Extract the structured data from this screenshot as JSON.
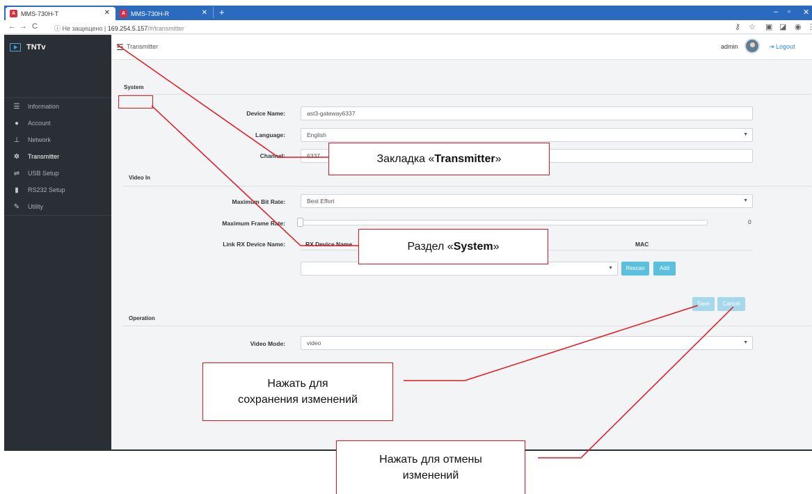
{
  "browser": {
    "tabs": [
      {
        "title": "MMS-730H-T",
        "favicon": "angular-icon",
        "active": true
      },
      {
        "title": "MMS-730H-R",
        "favicon": "angular-icon",
        "active": false
      }
    ],
    "new_tab": "+",
    "window_controls": {
      "minimize": "–",
      "maximize": "▫",
      "close": "✕"
    },
    "address": {
      "security_label": "Не защищено",
      "host": "169.254.5.157",
      "path": "/#/transmitter"
    }
  },
  "app": {
    "brand": "TNTv",
    "breadcrumb": "Transmitter",
    "user": "admin",
    "logout": "Logout",
    "sidebar": [
      {
        "label": "Information",
        "icon": "list-icon",
        "active": false
      },
      {
        "label": "Account",
        "icon": "user-icon",
        "active": false
      },
      {
        "label": "Network",
        "icon": "sitemap-icon",
        "active": false
      },
      {
        "label": "Transmitter",
        "icon": "gear-icon",
        "active": true
      },
      {
        "label": "USB Setup",
        "icon": "usb-icon",
        "active": false
      },
      {
        "label": "RS232 Setup",
        "icon": "port-icon",
        "active": false
      },
      {
        "label": "Utility",
        "icon": "wrench-icon",
        "active": false
      }
    ]
  },
  "form": {
    "system": {
      "title": "System",
      "device_name_label": "Device Name:",
      "device_name_value": "ast3-gateway6337",
      "language_label": "Language:",
      "language_value": "English",
      "channel_label": "Channel:",
      "channel_value": "6337"
    },
    "video_in": {
      "title": "Video In",
      "max_bitrate_label": "Maximum Bit Rate:",
      "max_bitrate_value": "Best Effort",
      "max_framerate_label": "Maximum Frame Rate:",
      "max_framerate_value": "0",
      "link_rx_label": "Link RX Device Name:",
      "col_rx_device_name": "RX Device Name",
      "col_mac": "MAC",
      "rx_select_value": "",
      "rescan": "Rescan",
      "add": "Add"
    },
    "save": "Save",
    "cancel": "Cancel",
    "operation": {
      "title": "Operation",
      "video_mode_label": "Video Mode:",
      "video_mode_value": "video"
    }
  },
  "annotations": {
    "transmitter_tab": {
      "prefix": "Закладка «",
      "bold": "Transmitter",
      "suffix": "»"
    },
    "system_section": {
      "prefix": "Раздел «",
      "bold": "System",
      "suffix": "»"
    },
    "save_hint": {
      "line1": "Нажать для",
      "line2": "сохранения изменений"
    },
    "cancel_hint": {
      "line1": "Нажать для отмены",
      "line2": "изменений"
    },
    "color": "#e8141b"
  },
  "colors": {
    "sidebar_bg": "#2a2f35",
    "tabstrip": "#2b6bbf",
    "button": "#5bc0de",
    "link": "#2b8bd8"
  }
}
